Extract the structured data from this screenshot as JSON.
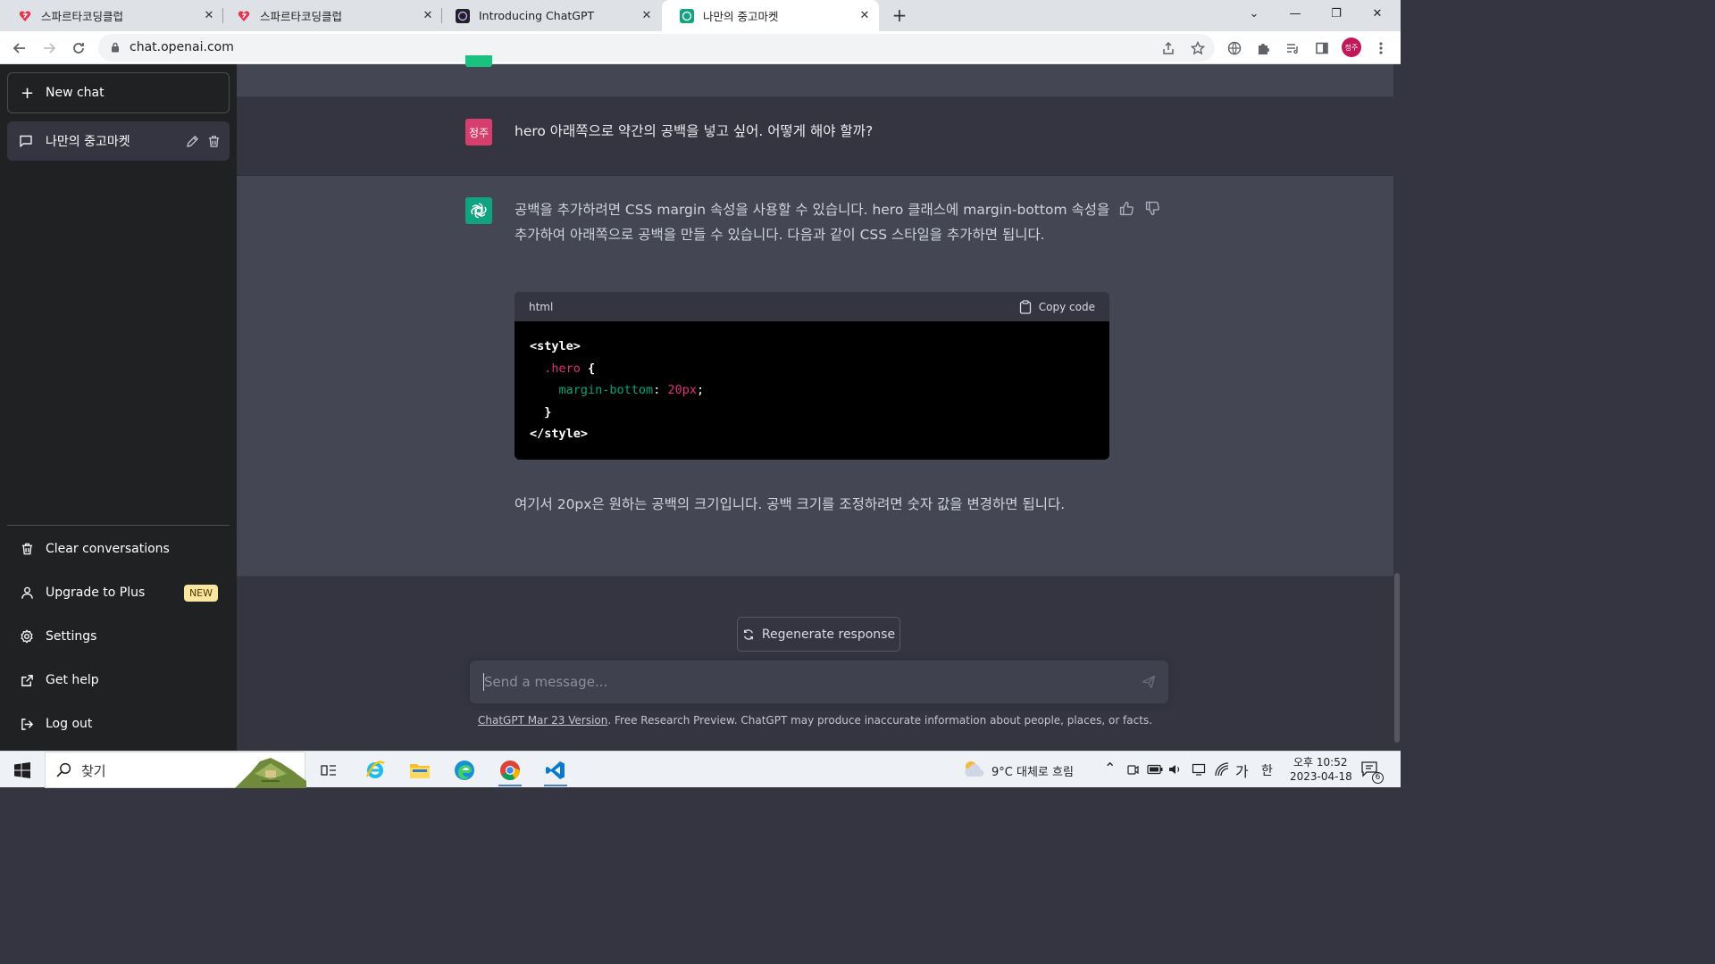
{
  "browser": {
    "tabs": [
      {
        "title": "스파르타코딩클럽"
      },
      {
        "title": "스파르타코딩클럽"
      },
      {
        "title": "Introducing ChatGPT"
      },
      {
        "title": "나만의 중고마켓"
      }
    ],
    "url": "chat.openai.com",
    "profile_initials": "정주"
  },
  "sidebar": {
    "new_chat": "New chat",
    "conversation": "나만의 중고마켓",
    "items": [
      {
        "label": "Clear conversations",
        "icon": "trash-icon"
      },
      {
        "label": "Upgrade to Plus",
        "icon": "user-icon",
        "badge": "NEW"
      },
      {
        "label": "Settings",
        "icon": "gear-icon"
      },
      {
        "label": "Get help",
        "icon": "external-link-icon"
      },
      {
        "label": "Log out",
        "icon": "logout-icon"
      }
    ]
  },
  "thread": {
    "user_avatar": "정주",
    "user_message": "hero 아래쪽으로 약간의 공백을 넣고 싶어. 어떻게 해야 할까?",
    "assistant_intro": "공백을 추가하려면 CSS margin 속성을 사용할 수 있습니다. hero 클래스에 margin-bottom 속성을 추가하여 아래쪽으로 공백을 만들 수 있습니다. 다음과 같이 CSS 스타일을 추가하면 됩니다.",
    "code_lang": "html",
    "copy_label": "Copy code",
    "code": {
      "open_tag": "<style>",
      "selector": ".hero",
      "brace_open": " {",
      "property": "margin-bottom",
      "colon": ": ",
      "value": "20px",
      "semicolon": ";",
      "brace_close": "}",
      "close_tag": "</style>"
    },
    "assistant_outro": "여기서 20px은 원하는 공백의 크기입니다. 공백 크기를 조정하려면 숫자 값을 변경하면 됩니다."
  },
  "composer": {
    "regenerate": "Regenerate response",
    "placeholder": "Send a message...",
    "footnote_link": "ChatGPT Mar 23 Version",
    "footnote_text": ". Free Research Preview. ChatGPT may produce inaccurate information about people, places, or facts."
  },
  "taskbar": {
    "search_label": "찾기",
    "weather": "9°C  대체로 흐림",
    "ime_mode": "가",
    "ime_lang": "한",
    "time": "오후 10:52",
    "date": "2023-04-18",
    "notification_count": "6"
  },
  "colors": {
    "sidebar_bg": "#202123",
    "main_bg": "#343541",
    "assistant_row_bg": "#444654",
    "brand_green": "#10a37f",
    "user_avatar": "#d63f6d",
    "badge_bg": "#fae69e"
  }
}
